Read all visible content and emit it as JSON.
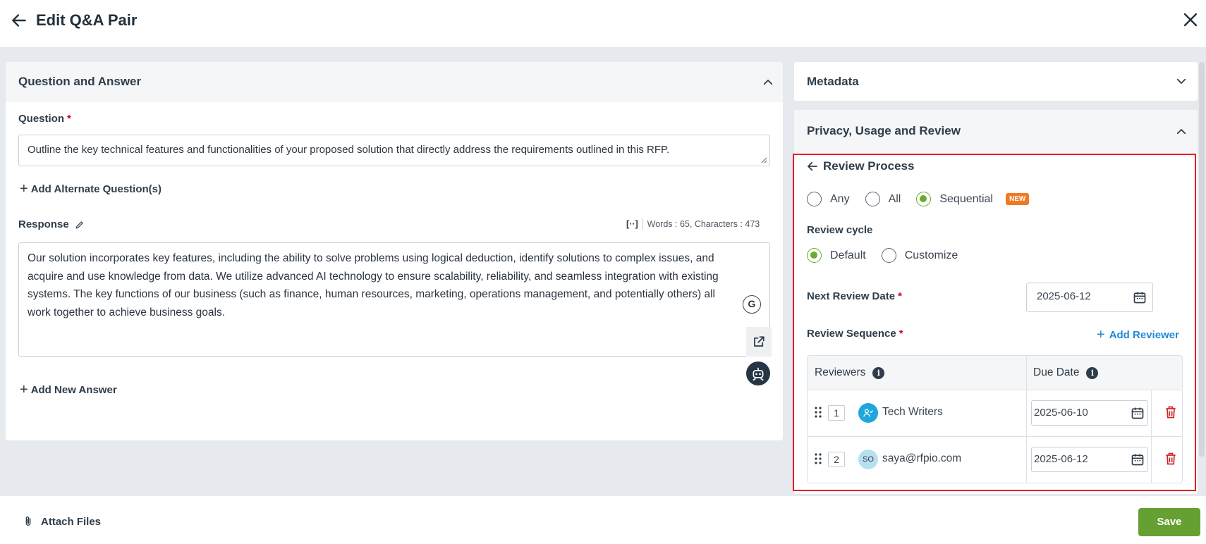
{
  "header": {
    "title": "Edit Q&A Pair",
    "back_icon": "arrow-left-icon",
    "close_icon": "close-icon"
  },
  "qa_panel": {
    "title": "Question and Answer",
    "question_label": "Question",
    "required_mark": "*",
    "question_text": "Outline the key technical features and functionalities of your proposed solution that directly address the requirements outlined in this RFP.",
    "add_alternate_label": "Add Alternate Question(s)",
    "response_label": "Response",
    "expand_icon_text": "[··]",
    "word_count": "Words : 65, Characters : 473",
    "response_text": "Our solution incorporates key features, including the ability to solve problems using logical deduction, identify solutions to complex issues, and acquire and use knowledge from data. We utilize advanced AI technology to ensure scalability, reliability, and seamless integration with existing systems. The key functions of our business (such as finance, human resources, marketing, operations management, and potentially others) all work together to achieve business goals.",
    "grammar_button": "G",
    "add_answer_label": "Add New Answer"
  },
  "metadata": {
    "title": "Metadata"
  },
  "privacy": {
    "title": "Privacy, Usage and Review",
    "review_process_title": "Review Process",
    "review_modes": [
      {
        "label": "Any",
        "selected": false
      },
      {
        "label": "All",
        "selected": false
      },
      {
        "label": "Sequential",
        "selected": true,
        "badge": "NEW"
      }
    ],
    "review_cycle_label": "Review cycle",
    "review_cycles": [
      {
        "label": "Default",
        "selected": true
      },
      {
        "label": "Customize",
        "selected": false
      }
    ],
    "next_review_label": "Next Review Date",
    "next_review_date": "2025-06-12",
    "review_sequence_label": "Review Sequence",
    "add_reviewer_label": "Add Reviewer",
    "table": {
      "col_reviewers": "Reviewers",
      "col_due_date": "Due Date",
      "rows": [
        {
          "index": "1",
          "avatar": "",
          "avatar_type": "group-icon",
          "name": "Tech Writers",
          "due": "2025-06-10"
        },
        {
          "index": "2",
          "avatar": "SO",
          "avatar_type": "initials",
          "name": "saya@rfpio.com",
          "due": "2025-06-12"
        }
      ]
    }
  },
  "footer": {
    "attach_label": "Attach Files",
    "save_label": "Save"
  },
  "colors": {
    "accent_green": "#66a032",
    "link_blue": "#1f8ad6",
    "highlight_red": "#e01f26",
    "badge_orange": "#f07a24",
    "delete_red": "#d0222a"
  }
}
